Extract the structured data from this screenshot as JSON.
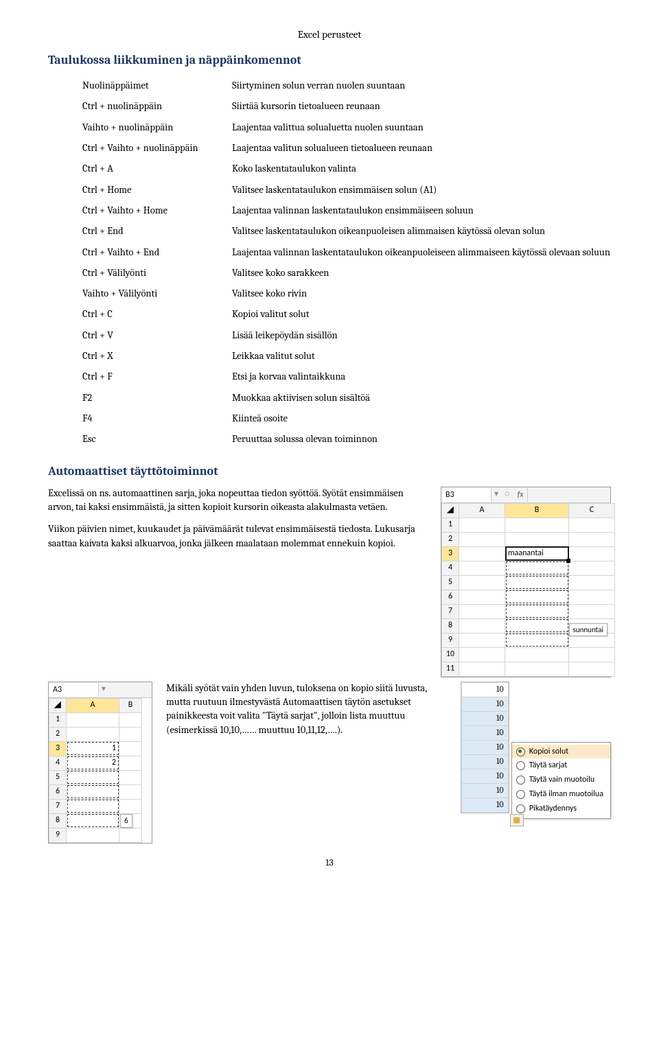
{
  "header": {
    "title": "Excel perusteet"
  },
  "section1": {
    "heading": "Taulukossa liikkuminen ja näppäinkomennot"
  },
  "shortcuts": [
    {
      "key": "Nuolinäppäimet",
      "desc": "Siirtyminen solun verran nuolen suuntaan"
    },
    {
      "key": "Ctrl + nuolinäppäin",
      "desc": "Siirtää kursorin tietoalueen reunaan"
    },
    {
      "key": "Vaihto + nuolinäppäin",
      "desc": "Laajentaa valittua solualuetta nuolen suuntaan"
    },
    {
      "key": "Ctrl + Vaihto + nuolinäppäin",
      "desc": "Laajentaa valitun solualueen tietoalueen reunaan"
    },
    {
      "key": "Ctrl + A",
      "desc": "Koko laskentataulukon valinta"
    },
    {
      "key": "Ctrl + Home",
      "desc": "Valitsee laskentataulukon ensimmäisen solun (A1)"
    },
    {
      "key": "Ctrl + Vaihto + Home",
      "desc": "Laajentaa valinnan laskentataulukon ensimmäiseen soluun"
    },
    {
      "key": "Ctrl + End",
      "desc": "Valitsee laskentataulukon oikeanpuoleisen alimmaisen käytössä olevan solun"
    },
    {
      "key": "Ctrl + Vaihto + End",
      "desc": "Laajentaa valinnan laskentataulukon oikeanpuoleiseen alimmaiseen käytössä olevaan soluun"
    },
    {
      "key": "Ctrl + Välilyönti",
      "desc": "Valitsee koko sarakkeen"
    },
    {
      "key": "Vaihto + Välilyönti",
      "desc": "Valitsee koko rivin"
    },
    {
      "key": "Ctrl + C",
      "desc": "Kopioi valitut solut"
    },
    {
      "key": "Ctrl + V",
      "desc": "Lisää leikepöydän sisällön"
    },
    {
      "key": "Ctrl + X",
      "desc": "Leikkaa valitut solut"
    },
    {
      "key": "Ctrl + F",
      "desc": "Etsi ja korvaa valintaikkuna"
    },
    {
      "key": "F2",
      "desc": "Muokkaa aktiivisen solun sisältöä"
    },
    {
      "key": "F4",
      "desc": "Kiinteä osoite"
    },
    {
      "key": "Esc",
      "desc": "Peruuttaa solussa olevan toiminnon"
    }
  ],
  "section2": {
    "heading": "Automaattiset täyttötoiminnot",
    "para1": "Excelissä on ns. automaattinen sarja, joka nopeuttaa tiedon syöttöä. Syötät ensimmäisen arvon, tai kaksi ensimmäistä, ja sitten kopioit kursorin oikeasta alakulmasta vetäen.",
    "para2": "Viikon päivien nimet, kuukaudet ja päivämäärät tulevat ensimmäisestä tiedosta. Lukusarja saattaa kaivata kaksi alkuarvoa, jonka jälkeen maalataan molemmat ennekuin kopioi.",
    "para3": "Mikäli syötät vain yhden luvun, tuloksena on kopio siitä luvusta, mutta ruutuun ilmestyvästä Automaattisen täytön asetukset painikkeesta voit valita \"Täytä sarjat\", jolloin lista muuttuu (esimerkissä 10,10,…… muuttuu 10,11,12,….)."
  },
  "img1": {
    "namebox": "B3",
    "fx": "fx",
    "cols": [
      "A",
      "B",
      "C"
    ],
    "rows": [
      "1",
      "2",
      "3",
      "4",
      "5",
      "6",
      "7",
      "8",
      "9",
      "10",
      "11"
    ],
    "b3": "maanantai",
    "tooltip": "sunnuntai"
  },
  "img2": {
    "namebox": "A3",
    "cols": [
      "A",
      "B"
    ],
    "rows": [
      "1",
      "2",
      "3",
      "4",
      "5",
      "6",
      "7",
      "8",
      "9"
    ],
    "a3": "1",
    "a4": "2",
    "tooltip": "6"
  },
  "img3": {
    "values": [
      "10",
      "10",
      "10",
      "10",
      "10",
      "10",
      "10",
      "10",
      "10"
    ],
    "menu": [
      "Kopioi solut",
      "Täytä sarjat",
      "Täytä vain muotoilu",
      "Täytä ilman muotoilua",
      "Pikatäydennys"
    ],
    "btn": "⋯"
  },
  "pagenum": "13"
}
